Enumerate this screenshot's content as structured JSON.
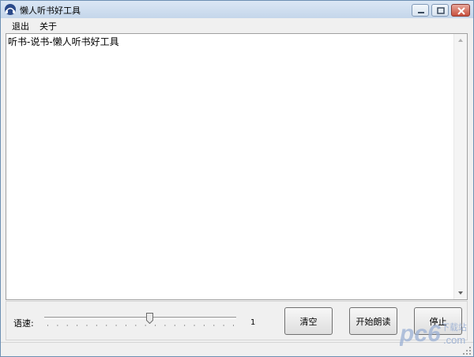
{
  "window": {
    "title": "懒人听书好工具"
  },
  "menu": {
    "items": [
      "退出",
      "关于"
    ]
  },
  "editor": {
    "text": "听书-说书-懒人听书好工具"
  },
  "controls": {
    "speed_label": "语速:",
    "speed_value": "1",
    "speed_level": 0.55,
    "clear_label": "清空",
    "start_label": "开始朗读",
    "stop_label": "停止"
  },
  "watermark": {
    "text": "pc6",
    "subtext": "下载站",
    "domain": ".com"
  },
  "colors": {
    "title_gradient": "#c5d6ea",
    "close_button": "#c8503e",
    "window_bg": "#f0f0f0",
    "watermark": "#9bb0d4"
  }
}
